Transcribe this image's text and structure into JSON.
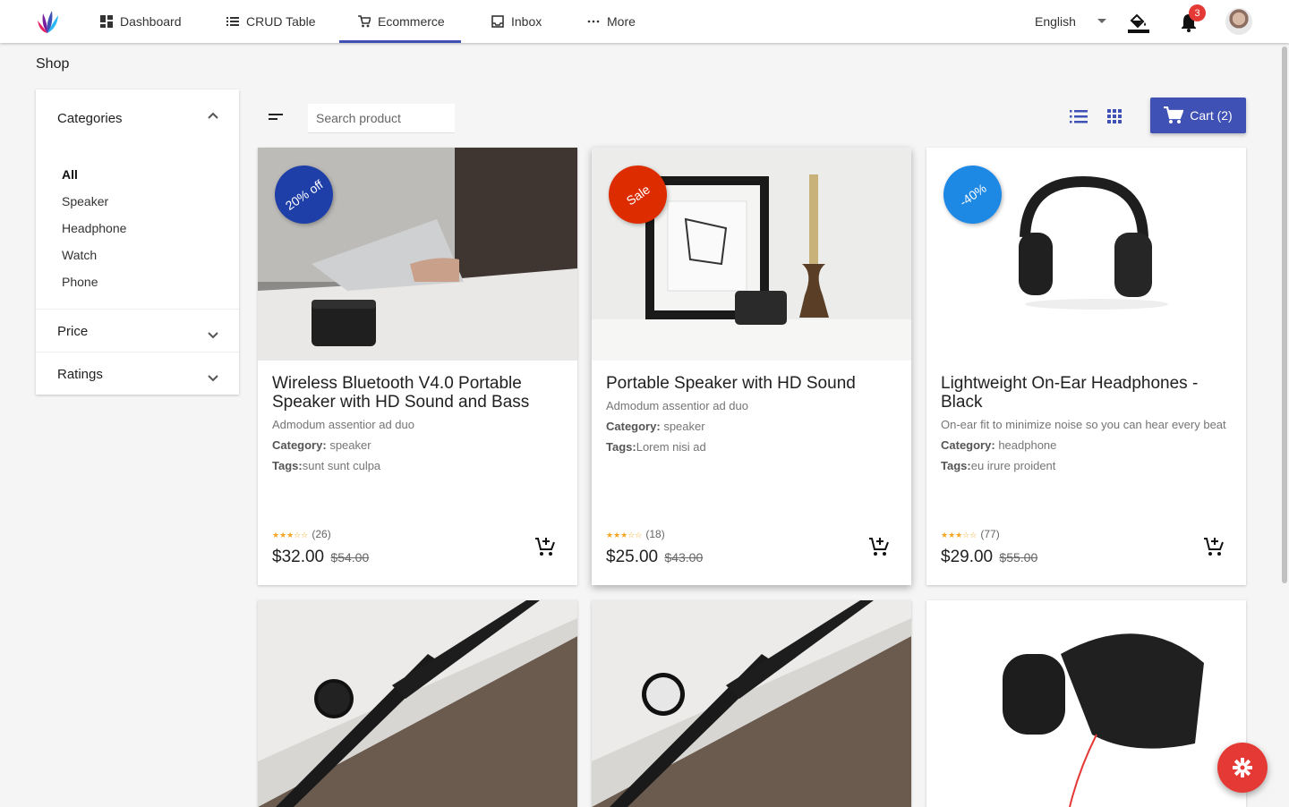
{
  "nav": {
    "items": [
      {
        "label": "Dashboard",
        "icon": "dashboard-icon"
      },
      {
        "label": "CRUD Table",
        "icon": "list-icon"
      },
      {
        "label": "Ecommerce",
        "icon": "cart-icon"
      },
      {
        "label": "Inbox",
        "icon": "inbox-icon"
      },
      {
        "label": "More",
        "icon": "more-icon"
      }
    ],
    "active": "Ecommerce",
    "language": "English",
    "notifications": "3",
    "accent": "#3f51b5"
  },
  "page": {
    "title": "Shop"
  },
  "sidebar": {
    "categories_label": "Categories",
    "categories": [
      "All",
      "Speaker",
      "Headphone",
      "Watch",
      "Phone"
    ],
    "selected": "All",
    "price_label": "Price",
    "ratings_label": "Ratings"
  },
  "toolbar": {
    "search_placeholder": "Search product",
    "cart_label": "Cart (2)"
  },
  "products": [
    {
      "ribbon": "20% off",
      "ribbon_color": "#1e3ea8",
      "title": "Wireless Bluetooth V4.0 Portable Speaker with HD Sound and Bass",
      "desc": "Admodum assentior ad duo",
      "category_label": "Category:",
      "category": "speaker",
      "tags_label": "Tags:",
      "tags": "sunt sunt culpa",
      "rating": 3,
      "reviews": "(26)",
      "price": "$32.00",
      "old_price": "$54.00"
    },
    {
      "ribbon": "Sale",
      "ribbon_color": "#dd2c00",
      "title": "Portable Speaker with HD Sound",
      "desc": "Admodum assentior ad duo",
      "category_label": "Category:",
      "category": "speaker",
      "tags_label": "Tags:",
      "tags": "Lorem nisi ad",
      "rating": 3,
      "reviews": "(18)",
      "price": "$25.00",
      "old_price": "$43.00"
    },
    {
      "ribbon": "-40%",
      "ribbon_color": "#1e88e5",
      "title": "Lightweight On-Ear Headphones - Black",
      "desc": "On-ear fit to minimize noise so you can hear every beat",
      "category_label": "Category:",
      "category": "headphone",
      "tags_label": "Tags:",
      "tags": "eu irure proident",
      "rating": 3,
      "reviews": "(77)",
      "price": "$29.00",
      "old_price": "$55.00"
    }
  ]
}
